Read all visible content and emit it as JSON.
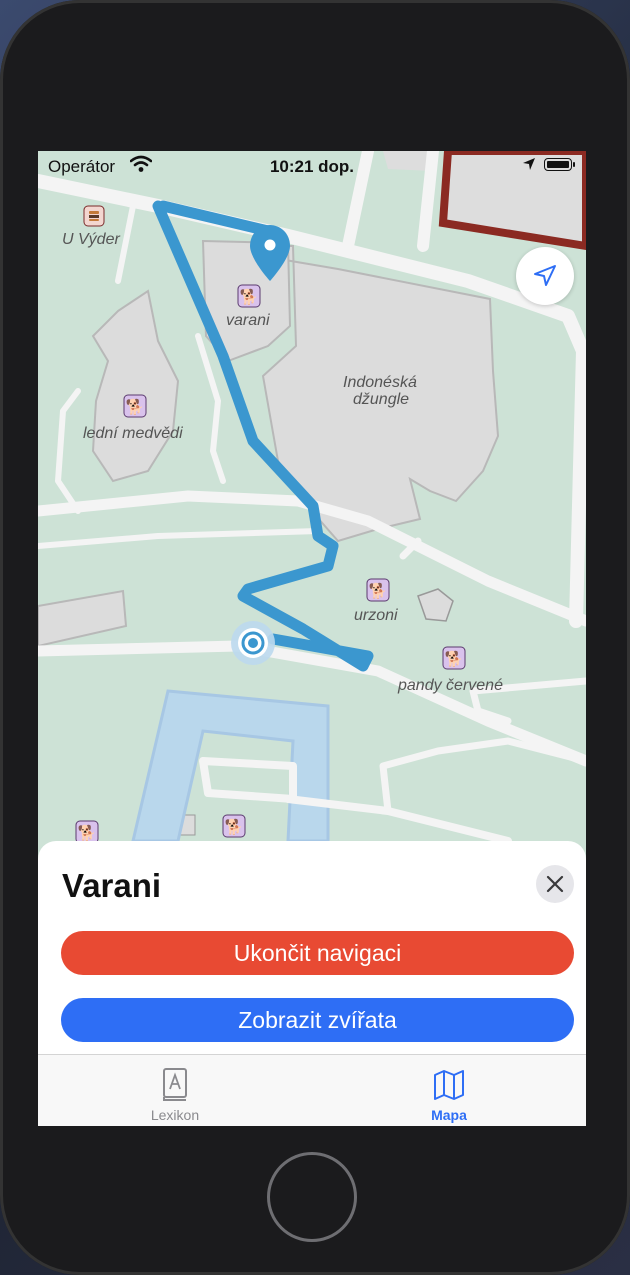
{
  "status_bar": {
    "carrier": "Operátor",
    "time": "10:21 dop."
  },
  "map": {
    "labels": {
      "u_vyder": "U Výder",
      "varani": "varani",
      "indonesian_jungle_line1": "Indonéská",
      "indonesian_jungle_line2": "džungle",
      "ledni_medvedi": "lední medvědi",
      "urzoni": "urzoni",
      "pandy_cervene": "pandy červené"
    },
    "icons": [
      "restaurant-icon",
      "animal-icon",
      "destination-pin-icon",
      "user-location-icon",
      "locate-me-icon"
    ],
    "route_color": "#3b97cf",
    "pin_color": "#3b97cf"
  },
  "sheet": {
    "title": "Varani",
    "end_navigation_label": "Ukončit navigaci",
    "show_animals_label": "Zobrazit zvířata",
    "end_color": "#e84a33",
    "show_color": "#2e6ef5"
  },
  "tab_bar": {
    "tabs": [
      {
        "label": "Lexikon",
        "icon": "book-icon",
        "selected": false
      },
      {
        "label": "Mapa",
        "icon": "map-icon",
        "selected": true
      }
    ]
  }
}
